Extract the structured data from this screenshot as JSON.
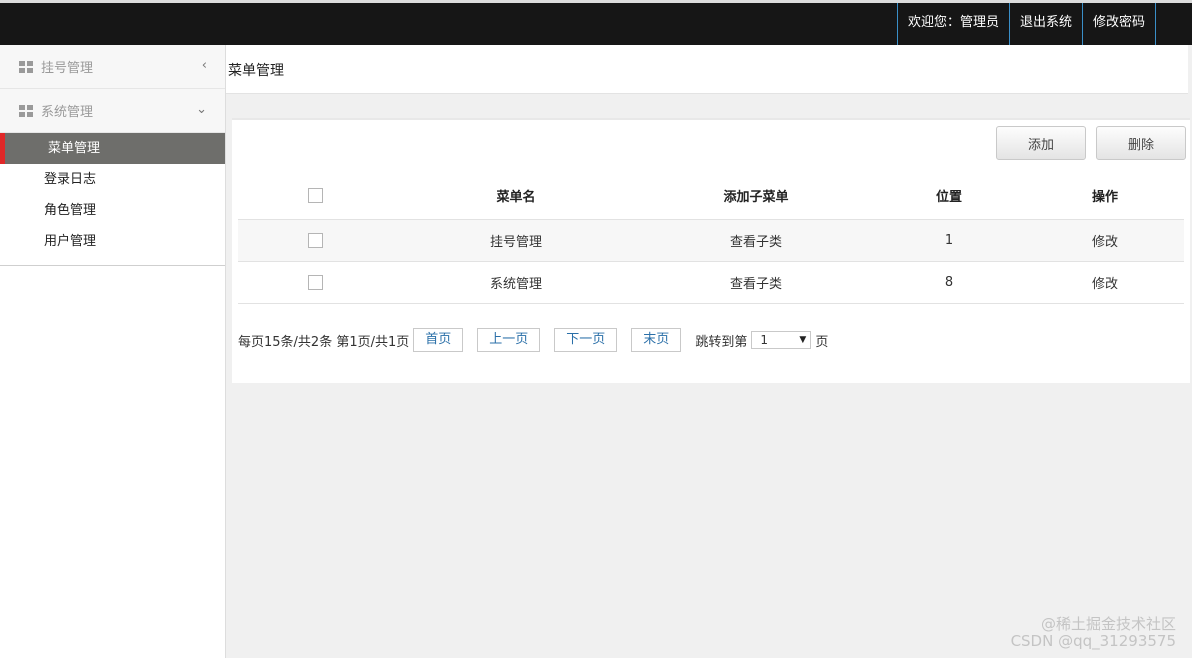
{
  "topnav": {
    "welcome": "欢迎您：管理员",
    "logout": "退出系统",
    "change_password": "修改密码"
  },
  "sidebar": {
    "groups": [
      {
        "label": "挂号管理",
        "icon": "grid-icon",
        "chevron": "‹"
      },
      {
        "label": "系统管理",
        "icon": "grid-icon",
        "chevron": "⌄"
      }
    ],
    "items": [
      {
        "label": "菜单管理",
        "active": true
      },
      {
        "label": "登录日志",
        "active": false
      },
      {
        "label": "角色管理",
        "active": false
      },
      {
        "label": "用户管理",
        "active": false
      }
    ]
  },
  "page": {
    "title": "菜单管理"
  },
  "toolbar": {
    "add_label": "添加",
    "delete_label": "删除"
  },
  "table": {
    "headers": [
      "菜单名",
      "添加子菜单",
      "位置",
      "操作"
    ],
    "rows": [
      {
        "name": "挂号管理",
        "sub": "查看子类",
        "position": "1",
        "action": "修改"
      },
      {
        "name": "系统管理",
        "sub": "查看子类",
        "position": "8",
        "action": "修改"
      }
    ]
  },
  "pager": {
    "info": "每页15条/共2条 第1页/共1页",
    "first": "首页",
    "prev": "上一页",
    "next": "下一页",
    "last": "末页",
    "jump_prefix": "跳转到第",
    "jump_value": "1",
    "jump_suffix": "页"
  },
  "watermark": {
    "line1": "@稀土掘金技术社区",
    "line2": "CSDN @qq_31293575"
  },
  "colors": {
    "topbar": "#161616",
    "active_item": "#6e6e6b",
    "active_marker": "#e02828"
  }
}
